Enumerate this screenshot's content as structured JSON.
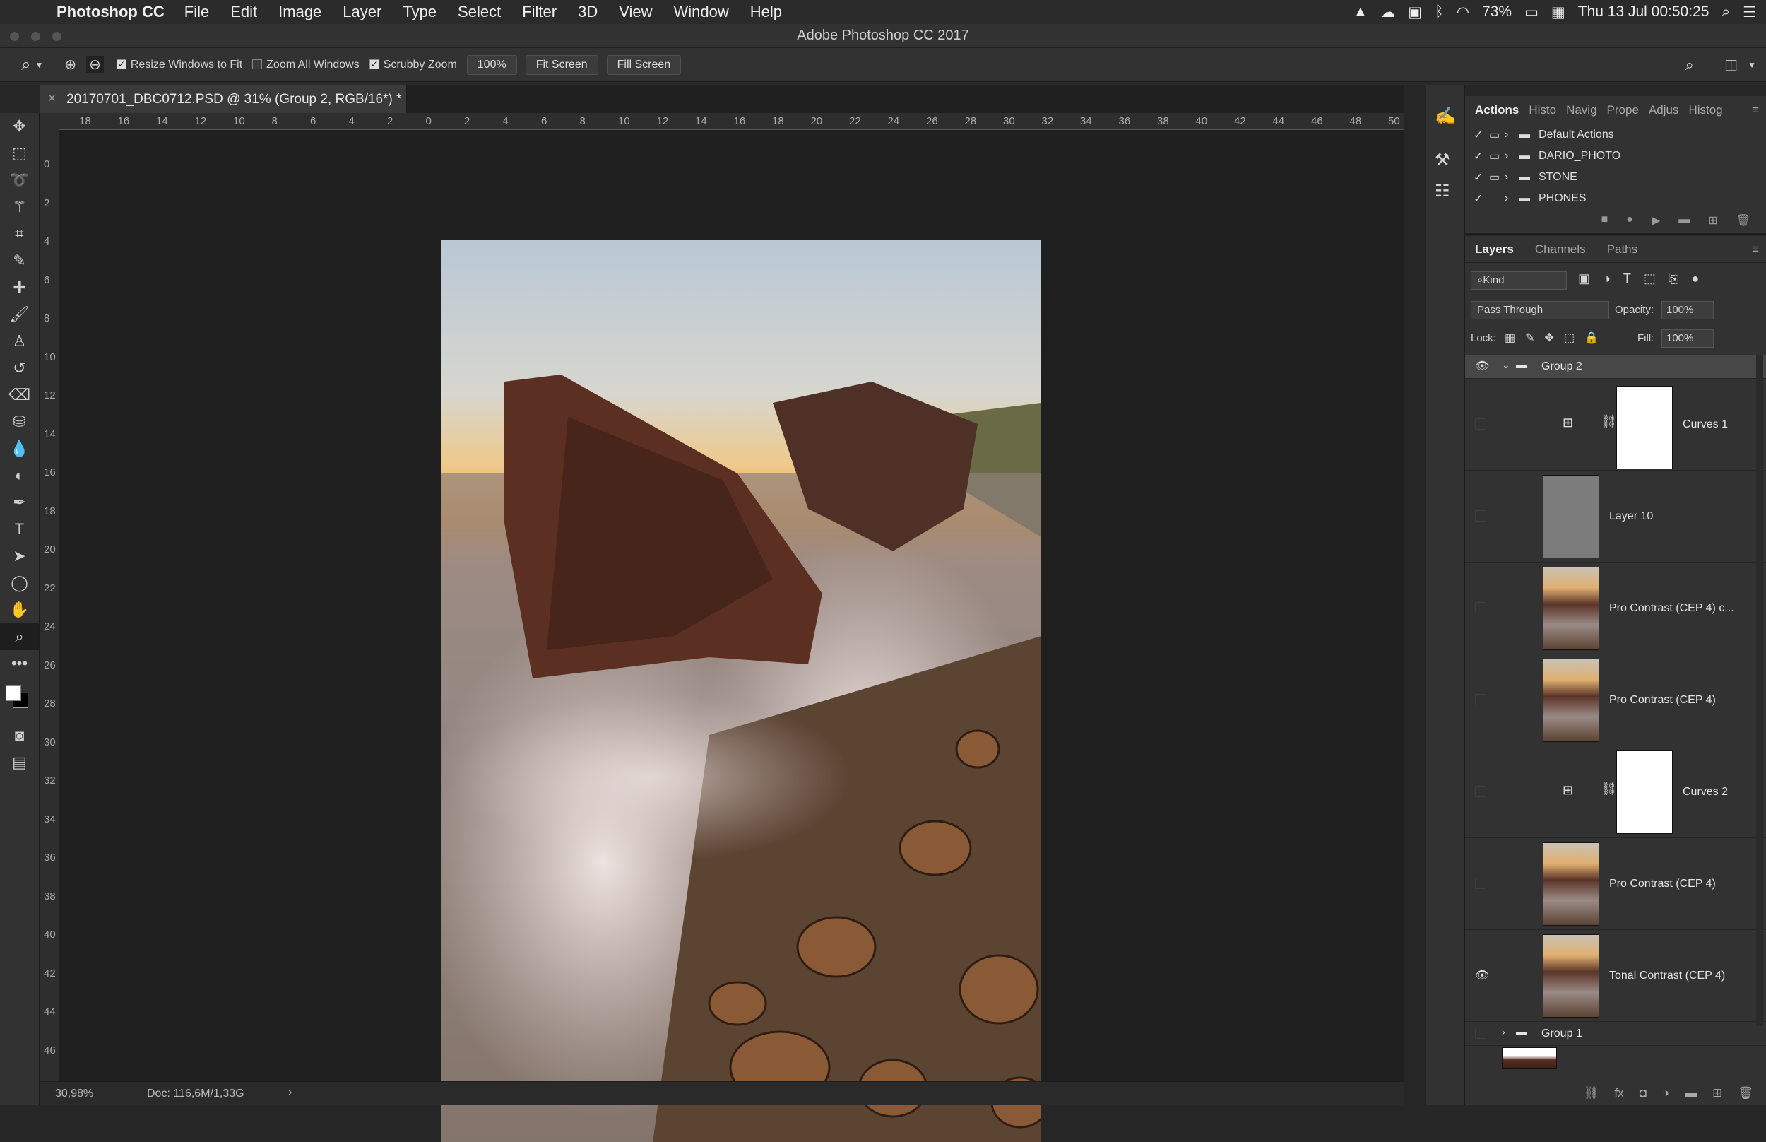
{
  "menubar": {
    "app_name": "Photoshop CC",
    "items": [
      "File",
      "Edit",
      "Image",
      "Layer",
      "Type",
      "Select",
      "Filter",
      "3D",
      "View",
      "Window",
      "Help"
    ],
    "battery": "73%",
    "clock": "Thu 13 Jul  00:50:25"
  },
  "window": {
    "title": "Adobe Photoshop CC 2017"
  },
  "options_bar": {
    "resize_windows": "Resize Windows to Fit",
    "zoom_all": "Zoom All Windows",
    "scrubby": "Scrubby Zoom",
    "zoom_value": "100%",
    "fit_screen": "Fit Screen",
    "fill_screen": "Fill Screen"
  },
  "document": {
    "tab_title": "20170701_DBC0712.PSD @ 31% (Group 2, RGB/16*) *",
    "ruler_h": [
      "18",
      "16",
      "14",
      "12",
      "10",
      "8",
      "6",
      "4",
      "2",
      "0",
      "2",
      "4",
      "6",
      "8",
      "10",
      "12",
      "14",
      "16",
      "18",
      "20",
      "22",
      "24",
      "26",
      "28",
      "30",
      "32",
      "34",
      "36",
      "38",
      "40",
      "42",
      "44",
      "46",
      "48",
      "50"
    ],
    "ruler_v": [
      "0",
      "2",
      "4",
      "6",
      "8",
      "10",
      "12",
      "14",
      "16",
      "18",
      "20",
      "22",
      "24",
      "26",
      "28",
      "30",
      "32",
      "34",
      "36",
      "38",
      "40",
      "42",
      "44",
      "46"
    ]
  },
  "status": {
    "zoom": "30,98%",
    "doc": "Doc: 116,6M/1,33G"
  },
  "actions_panel": {
    "tabs": [
      "Actions",
      "Histo",
      "Navig",
      "Prope",
      "Adjus",
      "Histog"
    ],
    "sets": [
      "Default Actions",
      "DARIO_PHOTO",
      "STONE",
      "PHONES"
    ]
  },
  "layers_panel": {
    "tabs": [
      "Layers",
      "Channels",
      "Paths"
    ],
    "filter_kind": "Kind",
    "blend_mode": "Pass Through",
    "opacity_label": "Opacity:",
    "opacity": "100%",
    "lock_label": "Lock:",
    "fill_label": "Fill:",
    "fill": "100%",
    "layers": [
      {
        "name": "Group 2",
        "type": "group",
        "visible": true
      },
      {
        "name": "Curves 1",
        "type": "adjustment",
        "visible": false
      },
      {
        "name": "Layer 10",
        "type": "gray",
        "visible": false
      },
      {
        "name": "Pro Contrast (CEP 4) c...",
        "type": "photo",
        "visible": false
      },
      {
        "name": "Pro Contrast (CEP 4)",
        "type": "photo",
        "visible": false
      },
      {
        "name": "Curves 2",
        "type": "adjustment",
        "visible": false
      },
      {
        "name": "Pro Contrast (CEP 4)",
        "type": "photo",
        "visible": false
      },
      {
        "name": "Tonal Contrast (CEP 4)",
        "type": "photo",
        "visible": true
      },
      {
        "name": "Group 1",
        "type": "group",
        "visible": false
      }
    ]
  }
}
